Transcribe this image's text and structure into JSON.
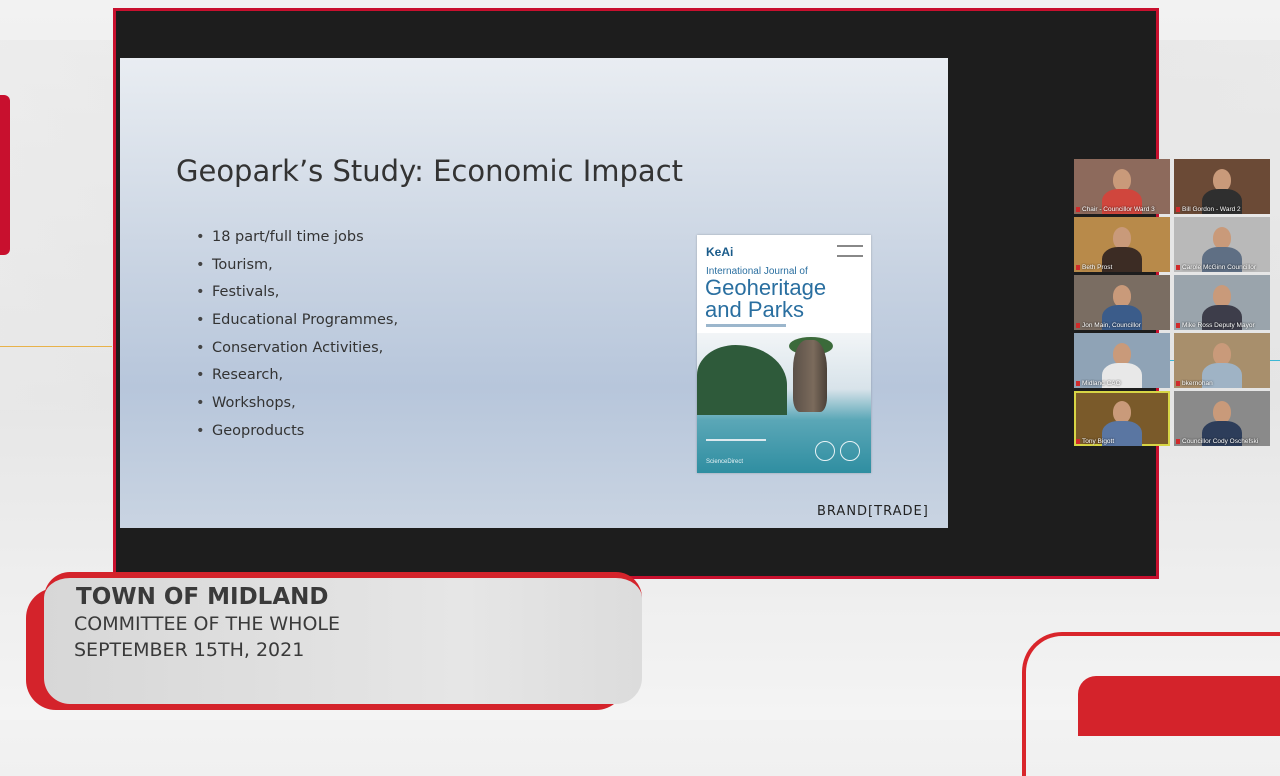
{
  "slide": {
    "title": "Geopark’s Study: Economic Impact",
    "bullets": [
      "18 part/full time jobs",
      "Tourism,",
      "Festivals,",
      "Educational Programmes,",
      "Conservation Activities,",
      "Research,",
      "Workshops,",
      "Geoproducts"
    ],
    "bullet_glyph": "•",
    "cover": {
      "publisher_logo": "KeAi",
      "line1": "International Journal of",
      "line2": "Geoheritage",
      "line3": "and Parks",
      "footer": "ScienceDirect"
    },
    "brand": "BRAND[TRADE]"
  },
  "participants": [
    {
      "name": "Chair - Councillor Ward 3",
      "bg": "#8d6a5c",
      "shirt": "#d0463d"
    },
    {
      "name": "Bill Gordon - Ward 2",
      "bg": "#6b4a36",
      "shirt": "#2f2f2f"
    },
    {
      "name": "Beth Prost",
      "bg": "#b88a4a",
      "shirt": "#3c2c24"
    },
    {
      "name": "Carole McGinn Councillor",
      "bg": "#b9b9b9",
      "shirt": "#5f6f84"
    },
    {
      "name": "Jon Main, Councillor",
      "bg": "#7a6d62",
      "shirt": "#3b5c8a"
    },
    {
      "name": "Mike Ross Deputy Mayor",
      "bg": "#9aa4ac",
      "shirt": "#3d3d4a"
    },
    {
      "name": "Midland CAO",
      "bg": "#8fa3b6",
      "shirt": "#e8e8e8"
    },
    {
      "name": "bkernohan",
      "bg": "#a88f6c",
      "shirt": "#9fb3c5"
    },
    {
      "name": "Tony Bigott",
      "bg": "#7a5a2a",
      "shirt": "#5a76a2"
    },
    {
      "name": "Councillor Cody Oschefski",
      "bg": "#8a8a8a",
      "shirt": "#2d3d5a"
    }
  ],
  "lower_third": {
    "org": "TOWN OF MIDLAND",
    "meeting": "COMMITTEE OF THE WHOLE",
    "date": "SEPTEMBER 15TH, 2021"
  }
}
